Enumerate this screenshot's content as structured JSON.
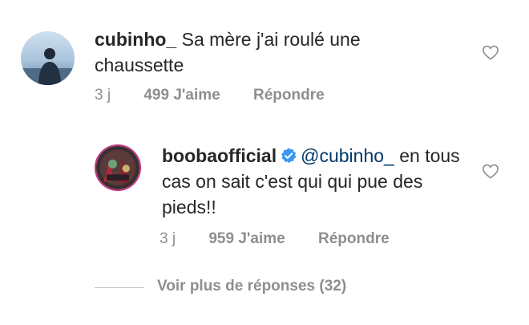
{
  "comments": [
    {
      "username": "cubinho_",
      "text": "Sa mère j'ai roulé une chaussette",
      "time": "3 j",
      "likes": "499 J'aime",
      "reply_label": "Répondre",
      "avatar_icon": "avatar-icon"
    },
    {
      "username": "boobaofficial",
      "verified": true,
      "mention": "@cubinho_",
      "text_after_mention": "en tous cas on sait c'est qui qui pue des pieds!!",
      "time": "3 j",
      "likes": "959 J'aime",
      "reply_label": "Répondre",
      "avatar_icon": "avatar-icon"
    }
  ],
  "view_more_label": "Voir plus de réponses (32)",
  "colors": {
    "text": "#262626",
    "secondary": "#8e8e8e",
    "mention": "#00376b",
    "verified": "#3897f0"
  }
}
